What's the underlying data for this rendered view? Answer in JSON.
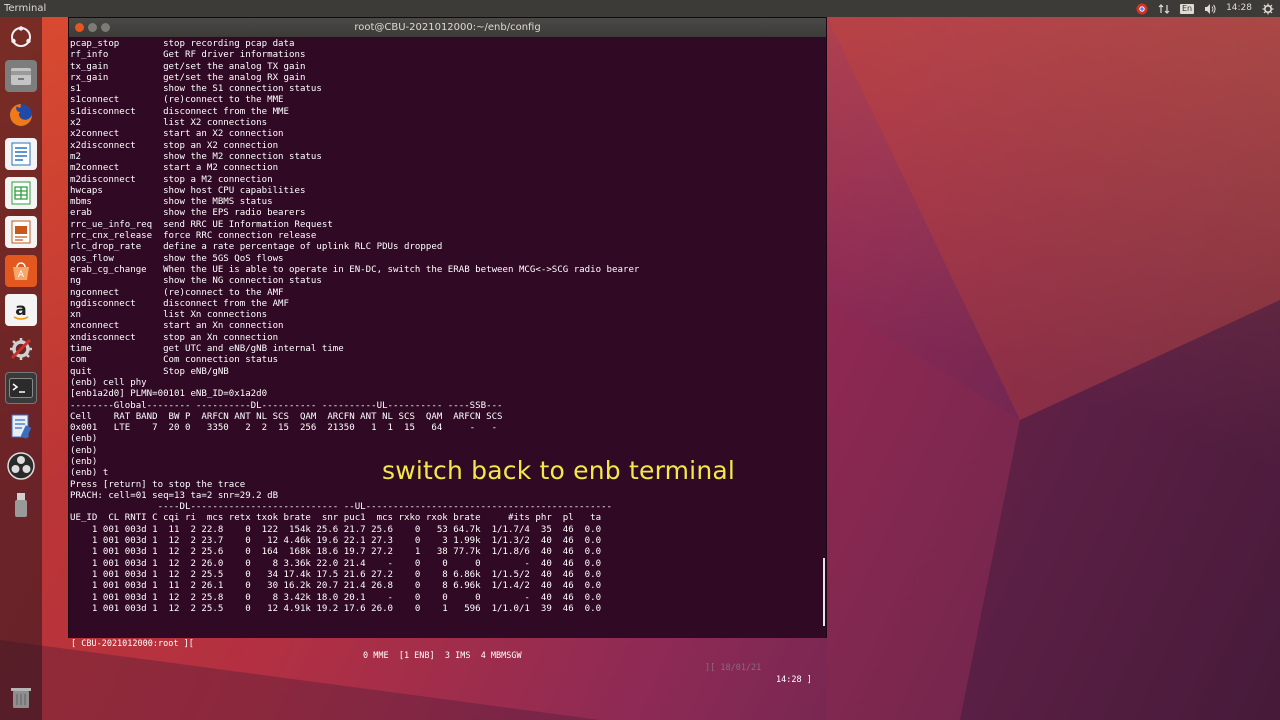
{
  "topbar": {
    "app_name": "Terminal",
    "lang": "En",
    "time": "14:28"
  },
  "launcher": {
    "items": [
      {
        "name": "dash-icon",
        "color": "#4c4c4c"
      },
      {
        "name": "files-icon",
        "color": "#8a8a8a"
      },
      {
        "name": "firefox-icon",
        "color": "#e66000"
      },
      {
        "name": "writer-icon",
        "color": "#2a72c4"
      },
      {
        "name": "calc-icon",
        "color": "#2e9e3c"
      },
      {
        "name": "impress-icon",
        "color": "#c65a1e"
      },
      {
        "name": "software-center-icon",
        "color": "#e2581e"
      },
      {
        "name": "amazon-icon",
        "color": "#222222"
      },
      {
        "name": "system-settings-icon",
        "color": "#c9302c"
      },
      {
        "name": "terminal-icon",
        "color": "#2b2b2b"
      },
      {
        "name": "text-editor-icon",
        "color": "#3a6fc0"
      },
      {
        "name": "obs-icon",
        "color": "#333333"
      },
      {
        "name": "usb-drive-icon",
        "color": "#777777"
      },
      {
        "name": "trash-icon",
        "color": "#6b6b6b"
      }
    ]
  },
  "terminal": {
    "title": "root@CBU-2021012000:~/enb/config",
    "lines": [
      "pcap_stop        stop recording pcap data",
      "rf_info          Get RF driver informations",
      "tx_gain          get/set the analog TX gain",
      "rx_gain          get/set the analog RX gain",
      "s1               show the S1 connection status",
      "s1connect        (re)connect to the MME",
      "s1disconnect     disconnect from the MME",
      "x2               list X2 connections",
      "x2connect        start an X2 connection",
      "x2disconnect     stop an X2 connection",
      "m2               show the M2 connection status",
      "m2connect        start a M2 connection",
      "m2disconnect     stop a M2 connection",
      "hwcaps           show host CPU capabilities",
      "mbms             show the MBMS status",
      "erab             show the EPS radio bearers",
      "rrc_ue_info_req  send RRC UE Information Request",
      "rrc_cnx_release  force RRC connection release",
      "rlc_drop_rate    define a rate percentage of uplink RLC PDUs dropped",
      "qos_flow         show the 5GS QoS flows",
      "erab_cg_change   When the UE is able to operate in EN-DC, switch the ERAB between MCG<->SCG radio bearer",
      "ng               show the NG connection status",
      "ngconnect        (re)connect to the AMF",
      "ngdisconnect     disconnect from the AMF",
      "xn               list Xn connections",
      "xnconnect        start an Xn connection",
      "xndisconnect     stop an Xn connection",
      "time             get UTC and eNB/gNB internal time",
      "com              Com connection status",
      "quit             Stop eNB/gNB",
      "(enb) cell phy",
      "[enb1a2d0] PLMN=00101 eNB_ID=0x1a2d0",
      "--------Global-------- ----------DL---------- ----------UL---------- ----SSB---",
      "Cell    RAT BAND  BW P  ARFCN ANT NL SCS  QAM  ARCFN ANT NL SCS  QAM  ARFCN SCS",
      "0x001   LTE    7  20 0   3350   2  2  15  256  21350   1  1  15   64     -   -",
      "(enb)",
      "(enb)",
      "(enb)",
      "(enb) t",
      "Press [return] to stop the trace",
      "PRACH: cell=01 seq=13 ta=2 snr=29.2 dB",
      "                ----DL--------------------------- --UL---------------------------------------------",
      "UE_ID  CL RNTI C cqi ri  mcs retx txok brate  snr puc1  mcs rxko rxok brate     #its phr  pl   ta",
      "    1 001 003d 1  11  2 22.8    0  122  154k 25.6 21.7 25.6    0   53 64.7k  1/1.7/4  35  46  0.0",
      "    1 001 003d 1  12  2 23.7    0   12 4.46k 19.6 22.1 27.3    0    3 1.99k  1/1.3/2  40  46  0.0",
      "    1 001 003d 1  12  2 25.6    0  164  168k 18.6 19.7 27.2    1   38 77.7k  1/1.8/6  40  46  0.0",
      "    1 001 003d 1  12  2 26.0    0    8 3.36k 22.0 21.4    -    0    0     0        -  40  46  0.0",
      "    1 001 003d 1  12  2 25.5    0   34 17.4k 17.5 21.6 27.2    0    8 6.86k  1/1.5/2  40  46  0.0",
      "    1 001 003d 1  11  2 26.1    0   30 16.2k 20.7 21.4 26.8    0    8 6.96k  1/1.4/2  40  46  0.0",
      "    1 001 003d 1  12  2 25.8    0    8 3.42k 18.0 20.1    -    0    0     0        -  40  46  0.0",
      "    1 001 003d 1  12  2 25.5    0   12 4.91k 19.2 17.6 26.0    0    1   596  1/1.0/1  39  46  0.0"
    ],
    "status_left": "[ CBU-2021012000:root ][",
    "status_mid": "0 MME  [1 ENB]  3 IMS  4 MBMSGW",
    "status_date": "][ 18/01/21",
    "status_time": "14:28 ]"
  },
  "caption": {
    "text": "switch back to enb terminal",
    "color": "#f3e84a"
  }
}
